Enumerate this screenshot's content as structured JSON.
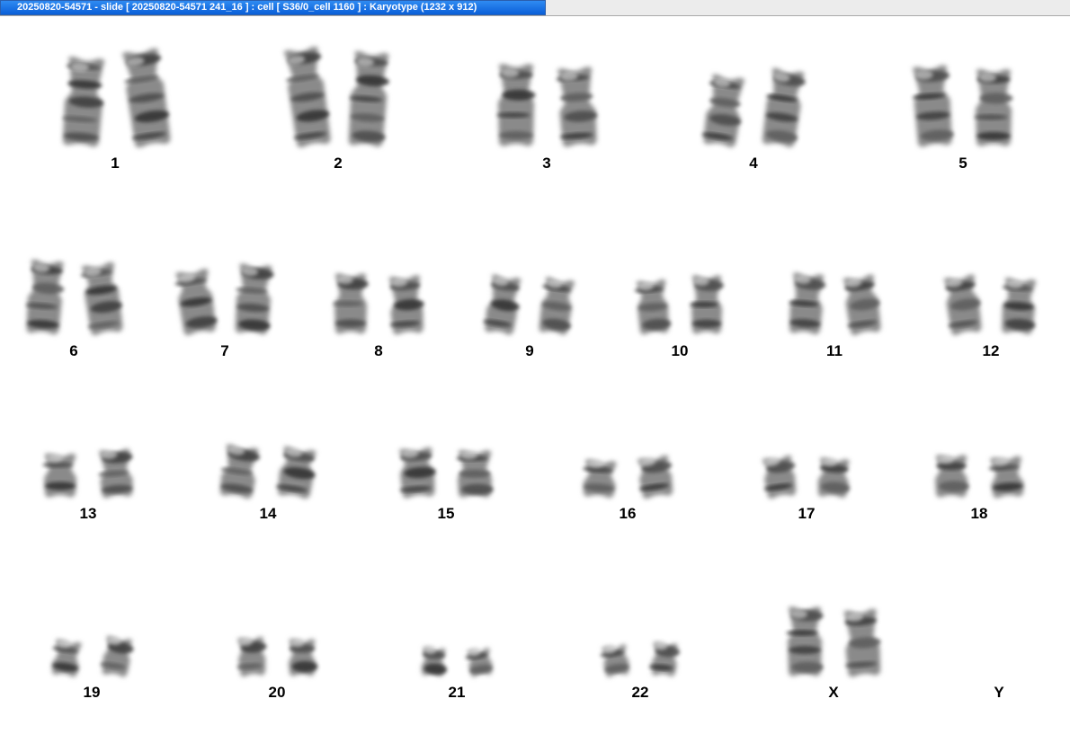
{
  "window": {
    "title": "20250820-54571 - slide [ 20250820-54571 241_16 ] : cell [ S36/0_cell 1160 ] : Karyotype  (1232 x 912)"
  },
  "karyotype": {
    "rows": [
      {
        "groups": [
          {
            "label": "1",
            "chromosomes": 2
          },
          {
            "label": "2",
            "chromosomes": 2
          },
          {
            "label": "3",
            "chromosomes": 2
          },
          {
            "label": "4",
            "chromosomes": 2
          },
          {
            "label": "5",
            "chromosomes": 2
          }
        ]
      },
      {
        "groups": [
          {
            "label": "6",
            "chromosomes": 2
          },
          {
            "label": "7",
            "chromosomes": 2
          },
          {
            "label": "8",
            "chromosomes": 2
          },
          {
            "label": "9",
            "chromosomes": 2
          },
          {
            "label": "10",
            "chromosomes": 2
          },
          {
            "label": "11",
            "chromosomes": 2
          },
          {
            "label": "12",
            "chromosomes": 2
          }
        ]
      },
      {
        "groups": [
          {
            "label": "13",
            "chromosomes": 2
          },
          {
            "label": "14",
            "chromosomes": 2
          },
          {
            "label": "15",
            "chromosomes": 2
          },
          {
            "label": "16",
            "chromosomes": 2
          },
          {
            "label": "17",
            "chromosomes": 2
          },
          {
            "label": "18",
            "chromosomes": 2
          }
        ]
      },
      {
        "groups": [
          {
            "label": "19",
            "chromosomes": 2
          },
          {
            "label": "20",
            "chromosomes": 2
          },
          {
            "label": "21",
            "chromosomes": 2
          },
          {
            "label": "22",
            "chromosomes": 2
          },
          {
            "label": "X",
            "chromosomes": 2
          },
          {
            "label": "Y",
            "chromosomes": 0
          }
        ]
      }
    ]
  }
}
